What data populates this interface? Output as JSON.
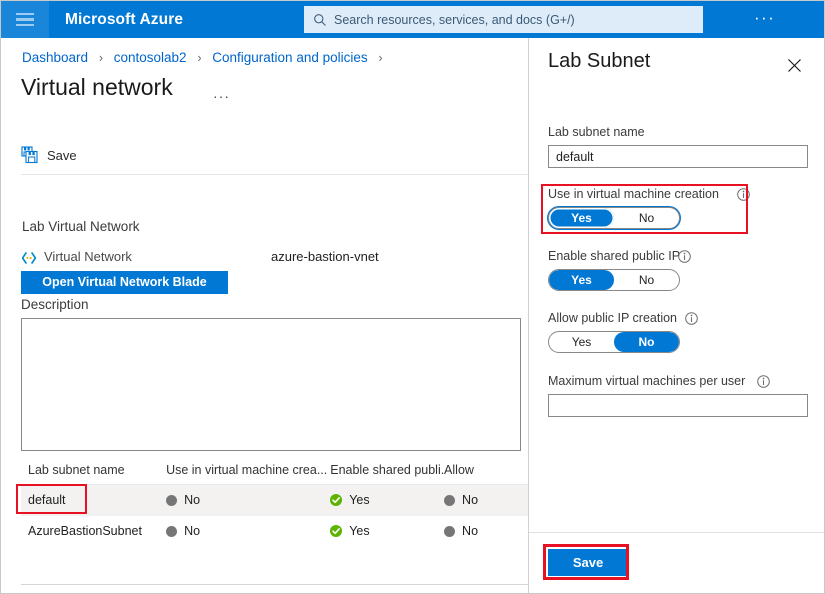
{
  "topbar": {
    "menu_icon": "hamburger-icon",
    "brand": "Microsoft Azure",
    "search_icon": "search-icon",
    "search_placeholder": "Search resources, services, and docs (G+/)",
    "search_value": "",
    "more_label": "···",
    "background": "#0078d4"
  },
  "breadcrumb": {
    "items": [
      "Dashboard",
      "contosolab2",
      "Configuration and policies"
    ],
    "separator": "›"
  },
  "page": {
    "title": "Virtual network",
    "title_more": "···"
  },
  "toolbar": {
    "save_label": "Save",
    "save_icon": "save-disk-icon"
  },
  "vnet_section": {
    "heading": "Lab Virtual Network",
    "row_icon": "virtual-network-icon",
    "row_label": "Virtual Network",
    "row_value": "azure-bastion-vnet",
    "open_blade_label": "Open Virtual Network Blade",
    "description_label": "Description",
    "description_value": "",
    "description_placeholder": ""
  },
  "table": {
    "columns": [
      "Lab subnet name",
      "Use in virtual machine crea...",
      "Enable shared publi...",
      "Allow"
    ],
    "rows": [
      {
        "name": "default",
        "use_in_vm": "No",
        "use_in_vm_state": "no",
        "shared_public_ip": "Yes",
        "shared_public_ip_state": "yes",
        "allow_public_ip": "No",
        "allow_public_ip_state": "no",
        "highlighted": true
      },
      {
        "name": "AzureBastionSubnet",
        "use_in_vm": "No",
        "use_in_vm_state": "no",
        "shared_public_ip": "Yes",
        "shared_public_ip_state": "yes",
        "allow_public_ip": "No",
        "allow_public_ip_state": "no",
        "highlighted": false
      }
    ]
  },
  "panel": {
    "title": "Lab Subnet",
    "close_icon": "close-icon",
    "subnet_name_label": "Lab subnet name",
    "subnet_name_value": "default",
    "fields": [
      {
        "label": "Use in virtual machine creation",
        "info_icon": "info-icon",
        "yes_label": "Yes",
        "no_label": "No",
        "selected": "Yes"
      },
      {
        "label": "Enable shared public IP",
        "info_icon": "info-icon",
        "yes_label": "Yes",
        "no_label": "No",
        "selected": "Yes"
      },
      {
        "label": "Allow public IP creation",
        "info_icon": "info-icon",
        "yes_label": "Yes",
        "no_label": "No",
        "selected": "No"
      }
    ],
    "max_vm_label": "Maximum virtual machines per user",
    "max_vm_info_icon": "info-icon",
    "max_vm_value": "",
    "save_label": "Save"
  },
  "colors": {
    "accent": "#0078d4",
    "highlight": "#e81123",
    "link": "#0066cc",
    "status_yes": "#5cb300",
    "status_no": "#767676",
    "row_alt": "#f3f2f1"
  }
}
